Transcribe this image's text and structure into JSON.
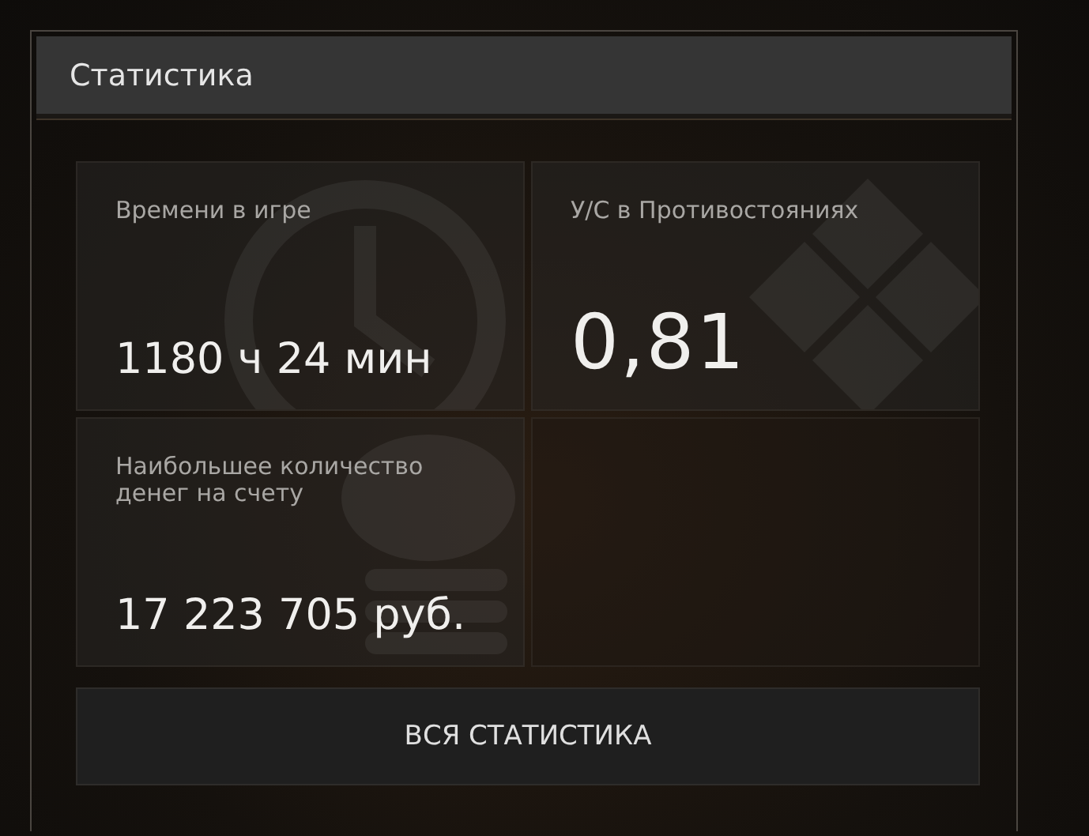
{
  "panel": {
    "title": "Статистика"
  },
  "cards": [
    {
      "kind": "stat",
      "label": "Времени в игре",
      "value": "1180 ч 24 мин"
    },
    {
      "kind": "stat",
      "label": "У/С в Противостояниях",
      "value": "0,81"
    },
    {
      "kind": "stat",
      "label": "Наибольшее количество денег на счету",
      "value": "17 223 705 руб."
    },
    {
      "kind": "empty"
    }
  ],
  "button": {
    "label": "ВСЯ СТАТИСТИКА"
  }
}
